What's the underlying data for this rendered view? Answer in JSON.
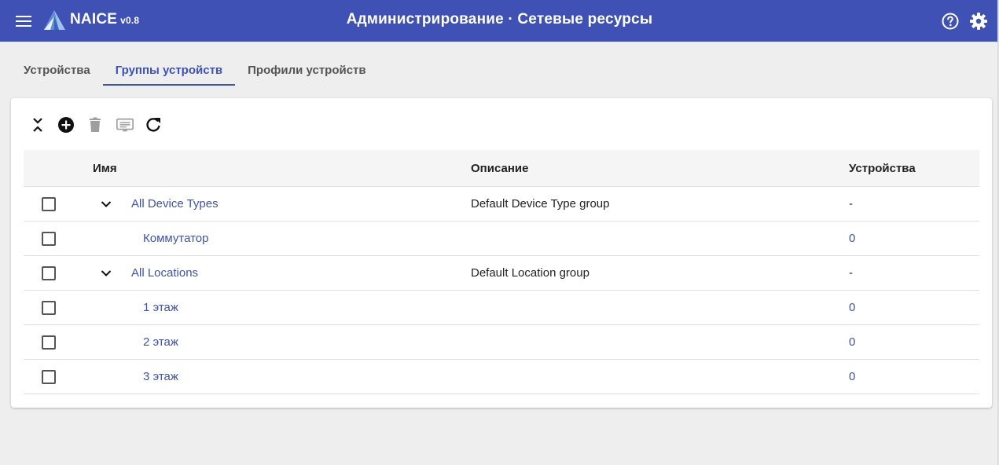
{
  "app": {
    "brand": "NAICE",
    "version": "v0.8",
    "title": "Администрирование · Сетевые ресурсы",
    "accent_color": "#3f51b5"
  },
  "icons": {
    "menu": "menu-icon",
    "logo": "naice-logo-icon",
    "help": "help-circle-icon",
    "settings": "gear-icon",
    "collapse_all": "unfold-less-icon",
    "add": "add-circle-icon",
    "delete": "trash-icon",
    "description": "message-box-icon",
    "refresh": "refresh-icon",
    "expand": "chevron-down-icon"
  },
  "tabs": [
    {
      "label": "Устройства",
      "active": false
    },
    {
      "label": "Группы устройств",
      "active": true
    },
    {
      "label": "Профили устройств",
      "active": false
    }
  ],
  "table": {
    "columns": {
      "name": "Имя",
      "description": "Описание",
      "devices": "Устройства"
    },
    "rows": [
      {
        "name": "All Device Types",
        "level": 0,
        "expandable": true,
        "description": "Default Device Type group",
        "devices": "-"
      },
      {
        "name": "Коммутатор",
        "level": 1,
        "expandable": false,
        "description": "",
        "devices": "0"
      },
      {
        "name": "All Locations",
        "level": 0,
        "expandable": true,
        "description": "Default Location group",
        "devices": "-"
      },
      {
        "name": "1 этаж",
        "level": 1,
        "expandable": false,
        "description": "",
        "devices": "0"
      },
      {
        "name": "2 этаж",
        "level": 1,
        "expandable": false,
        "description": "",
        "devices": "0"
      },
      {
        "name": "3 этаж",
        "level": 1,
        "expandable": false,
        "description": "",
        "devices": "0"
      }
    ]
  }
}
